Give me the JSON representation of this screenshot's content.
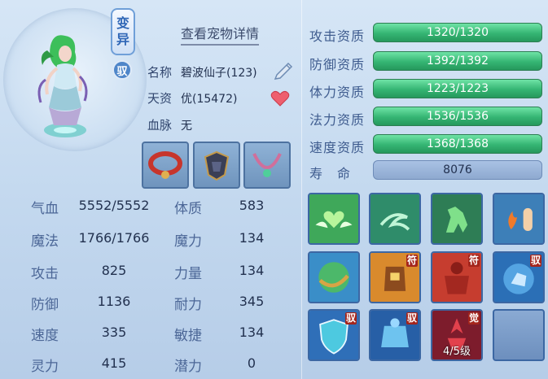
{
  "portrait": {
    "badge_bianyi": "变异",
    "badge_yu": "驭"
  },
  "header": {
    "detail_link": "查看宠物详情"
  },
  "info": {
    "name_label": "名称",
    "name_value": "碧波仙子(123)",
    "aptitude_label": "天资",
    "aptitude_value": "优(15472)",
    "bloodline_label": "血脉",
    "bloodline_value": "无"
  },
  "stats": [
    {
      "label": "气血",
      "value": "5552/5552"
    },
    {
      "label": "魔法",
      "value": "1766/1766"
    },
    {
      "label": "攻击",
      "value": "825"
    },
    {
      "label": "防御",
      "value": "1136"
    },
    {
      "label": "速度",
      "value": "335"
    },
    {
      "label": "灵力",
      "value": "415"
    }
  ],
  "attributes": [
    {
      "label": "体质",
      "value": "583"
    },
    {
      "label": "魔力",
      "value": "134"
    },
    {
      "label": "力量",
      "value": "134"
    },
    {
      "label": "耐力",
      "value": "345"
    },
    {
      "label": "敏捷",
      "value": "134"
    },
    {
      "label": "潜力",
      "value": "0"
    }
  ],
  "aptitudes": [
    {
      "label": "攻击资质",
      "value": "1320/1320",
      "fill": 1.0
    },
    {
      "label": "防御资质",
      "value": "1392/1392",
      "fill": 1.0
    },
    {
      "label": "体力资质",
      "value": "1223/1223",
      "fill": 1.0
    },
    {
      "label": "法力资质",
      "value": "1536/1536",
      "fill": 1.0
    },
    {
      "label": "速度资质",
      "value": "1368/1368",
      "fill": 1.0
    }
  ],
  "lifespan": {
    "label": "寿　命",
    "value": "8076"
  },
  "skills": [
    {
      "icon": "green-heart-wings-icon",
      "tag": ""
    },
    {
      "icon": "green-wind-swirl-icon",
      "tag": ""
    },
    {
      "icon": "green-horse-icon",
      "tag": ""
    },
    {
      "icon": "fire-hand-icon",
      "tag": ""
    },
    {
      "icon": "earth-water-orb-icon",
      "tag": ""
    },
    {
      "icon": "golden-warrior-icon",
      "tag": "符"
    },
    {
      "icon": "red-giant-icon",
      "tag": "符"
    },
    {
      "icon": "blue-beast-orb-icon",
      "tag": "驭"
    },
    {
      "icon": "blue-shield-icon",
      "tag": "驭"
    },
    {
      "icon": "blue-armor-icon",
      "tag": "驭"
    },
    {
      "icon": "red-awaken-icon",
      "tag": "觉",
      "level": "4/5级"
    },
    {
      "icon": "empty-slot",
      "tag": ""
    }
  ],
  "colors": {
    "aptitude_bar": "#35b573",
    "lifespan_bar": "#8ea9d0",
    "background": "#c4d9ef",
    "tag_red": "#a4251c"
  }
}
